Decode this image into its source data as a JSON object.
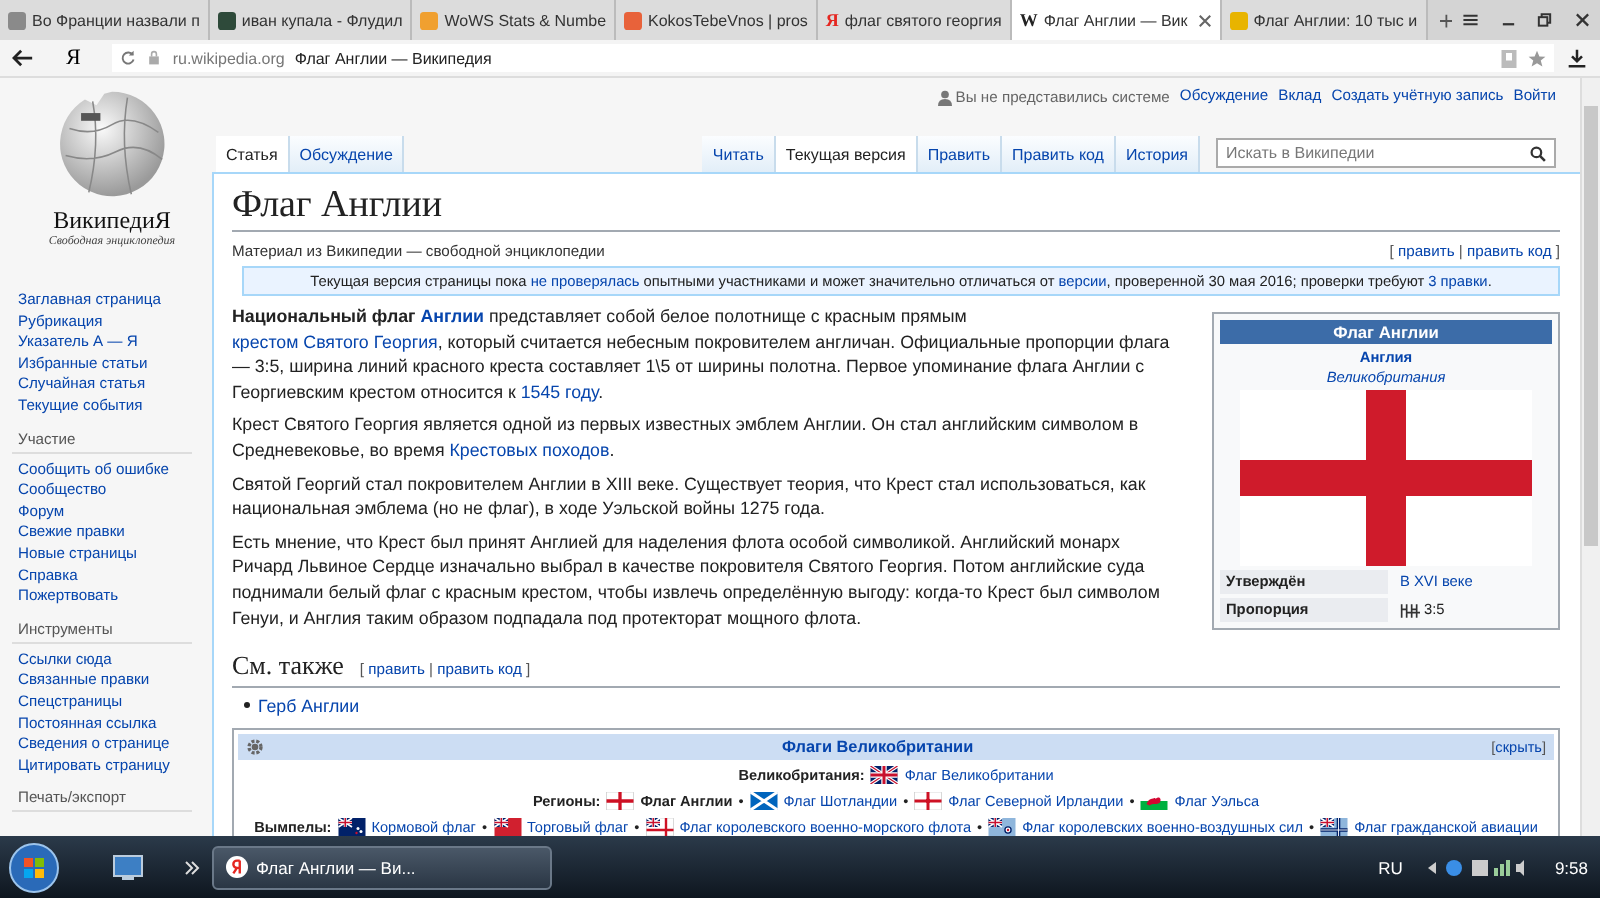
{
  "browser": {
    "tabs": [
      {
        "title": "Во Франции назвали п",
        "selected": false,
        "color": "#8a8a8a"
      },
      {
        "title": "иван купала - Флудил",
        "selected": false,
        "color": "#2e4a3a"
      },
      {
        "title": "WoWS Stats & Numbe",
        "selected": false,
        "color": "#f0a030"
      },
      {
        "title": "KokosTebeVnos | pros",
        "selected": false,
        "color": "#e8623a"
      },
      {
        "title": "флаг святого георгия",
        "selected": false,
        "color": "#e52620",
        "glyph": "Я"
      },
      {
        "title": "Флаг Англии — Вик",
        "selected": true,
        "color": "#222222",
        "glyph": "W"
      },
      {
        "title": "Флаг Англии: 10 тыс и",
        "selected": false,
        "color": "#e8b400"
      }
    ],
    "logo": "Я",
    "domain": "ru.wikipedia.org",
    "page_title": "Флаг Англии — Википедия"
  },
  "personal": {
    "user": "Вы не представились системе",
    "links": [
      "Обсуждение",
      "Вклад",
      "Создать учётную запись",
      "Войти"
    ]
  },
  "page_tabs": [
    {
      "label": "Статья",
      "selected": true
    },
    {
      "label": "Обсуждение",
      "selected": false
    }
  ],
  "views": [
    {
      "label": "Читать",
      "selected": false
    },
    {
      "label": "Текущая версия",
      "selected": true
    },
    {
      "label": "Править",
      "selected": false
    },
    {
      "label": "Править код",
      "selected": false
    },
    {
      "label": "История",
      "selected": false
    }
  ],
  "search": {
    "placeholder": "Искать в Википедии"
  },
  "sidebar": {
    "logo_name": "ВикипедиЯ",
    "tagline": "Свободная энциклопедия",
    "sections": [
      {
        "items": [
          "Заглавная страница",
          "Рубрикация",
          "Указатель А — Я",
          "Избранные статьи",
          "Случайная статья",
          "Текущие события"
        ]
      },
      {
        "heading": "Участие",
        "items": [
          "Сообщить об ошибке",
          "Сообщество",
          "Форум",
          "Свежие правки",
          "Новые страницы",
          "Справка",
          "Пожертвовать"
        ]
      },
      {
        "heading": "Инструменты",
        "items": [
          "Ссылки сюда",
          "Связанные правки",
          "Спецстраницы",
          "Постоянная ссылка",
          "Сведения о странице",
          "Цитировать страницу"
        ]
      },
      {
        "heading": "Печать/экспорт"
      }
    ]
  },
  "article": {
    "title": "Флаг Англии",
    "subtitle": "Материал из Википедии — свободной энциклопедии",
    "edit_links": [
      {
        "kind": "text",
        "text": "[ "
      },
      {
        "kind": "link",
        "text": "править"
      },
      {
        "kind": "text",
        "text": " | "
      },
      {
        "kind": "link",
        "text": "править код"
      },
      {
        "kind": "text",
        "text": " ]"
      }
    ],
    "notice": [
      {
        "kind": "text",
        "text": "Текущая версия страницы пока "
      },
      {
        "kind": "link",
        "text": "не проверялась"
      },
      {
        "kind": "text",
        "text": " опытными участниками и может значительно отличаться от "
      },
      {
        "kind": "link",
        "text": "версии"
      },
      {
        "kind": "text",
        "text": ", проверенной 30 мая 2016; проверки требуют "
      },
      {
        "kind": "link",
        "text": "3 правки"
      },
      {
        "kind": "text",
        "text": "."
      }
    ],
    "paragraphs": [
      [
        {
          "kind": "bold",
          "text": "Национальный флаг "
        },
        {
          "kind": "bold_link",
          "text": "Англии"
        },
        {
          "kind": "text",
          "text": " представляет собой белое полотнище с красным прямым "
        },
        {
          "kind": "link",
          "text": "крестом Святого Георгия"
        },
        {
          "kind": "text",
          "text": ", который считается небесным покровителем англичан. Официальные пропорции флага — 3:5, ширина линий красного креста составляет 1\\5 от ширины полотна. Первое упоминание флага Англии с Георгиевским крестом относится к "
        },
        {
          "kind": "link",
          "text": "1545 году"
        },
        {
          "kind": "text",
          "text": "."
        }
      ],
      [
        {
          "kind": "text",
          "text": "Крест Святого Георгия является одной из первых известных эмблем Англии. Он стал английским символом в Средневековье, во время "
        },
        {
          "kind": "link",
          "text": "Крестовых походов"
        },
        {
          "kind": "text",
          "text": "."
        }
      ],
      [
        {
          "kind": "text",
          "text": "Святой Георгий стал покровителем Англии в XIII веке. Существует теория, что Крест стал использоваться, как национальная эмблема (но не флаг), в ходе Уэльской войны 1275 года."
        }
      ],
      [
        {
          "kind": "text",
          "text": "Есть мнение, что Крест был принят Англией для наделения флота особой символикой. Английский монарх Ричард Львиное Сердце изначально выбрал в качестве покровителя Святого Георгия. Потом английские суда поднимали белый флаг с красным крестом, чтобы извлечь определённую выгоду: когда-то Крест был символом Генуи, и Англия таким образом подпадала под протекторат мощного флота."
        }
      ]
    ],
    "infobox": {
      "title": "Флаг Англии",
      "subject": "Англия",
      "country": "Великобритания",
      "rows": [
        {
          "label": "Утверждён",
          "value": "В XVI веке"
        },
        {
          "label": "Пропорция",
          "value": "3:5"
        }
      ]
    },
    "see_also": {
      "heading": "См. также",
      "edit_links": [
        {
          "kind": "text",
          "text": "[ "
        },
        {
          "kind": "link",
          "text": "править"
        },
        {
          "kind": "text",
          "text": " | "
        },
        {
          "kind": "link",
          "text": "править код"
        },
        {
          "kind": "text",
          "text": " ]"
        }
      ],
      "items": [
        "Герб Англии"
      ]
    },
    "navbox": {
      "title": "Флаги Великобритании",
      "toggle": [
        {
          "kind": "text",
          "text": "["
        },
        {
          "kind": "link",
          "text": "скрыть"
        },
        {
          "kind": "text",
          "text": "]"
        }
      ],
      "separator": "•",
      "rows": [
        {
          "label": "Великобритания:",
          "items": [
            {
              "kind": "union",
              "text": "Флаг Великобритании",
              "current": false
            }
          ]
        },
        {
          "label": "Регионы:",
          "items": [
            {
              "kind": "cross",
              "text": "Флаг Англии",
              "current": true
            },
            {
              "kind": "saltire",
              "text": "Флаг Шотландии",
              "current": false
            },
            {
              "kind": "ulster",
              "text": "Флаг Северной Ирландии",
              "current": false
            },
            {
              "kind": "wales",
              "text": "Флаг Уэльса",
              "current": false
            }
          ]
        },
        {
          "label": "Вымпелы:",
          "items": [
            {
              "kind": "blue_ensign",
              "text": "Кормовой флаг",
              "current": false
            },
            {
              "kind": "red_ensign",
              "text": "Торговый флаг",
              "current": false
            },
            {
              "kind": "white_ensign",
              "text": "Флаг королевского военно-морского флота",
              "current": false
            },
            {
              "kind": "air_ensign",
              "text": "Флаг королевских военно-воздушных сил",
              "current": false
            },
            {
              "kind": "civil_ensign",
              "text": "Флаг гражданской авиации",
              "current": false
            }
          ]
        }
      ]
    }
  },
  "taskbar": {
    "window": "Флаг Англии — Ви...",
    "language": "RU",
    "time": "9:58"
  }
}
